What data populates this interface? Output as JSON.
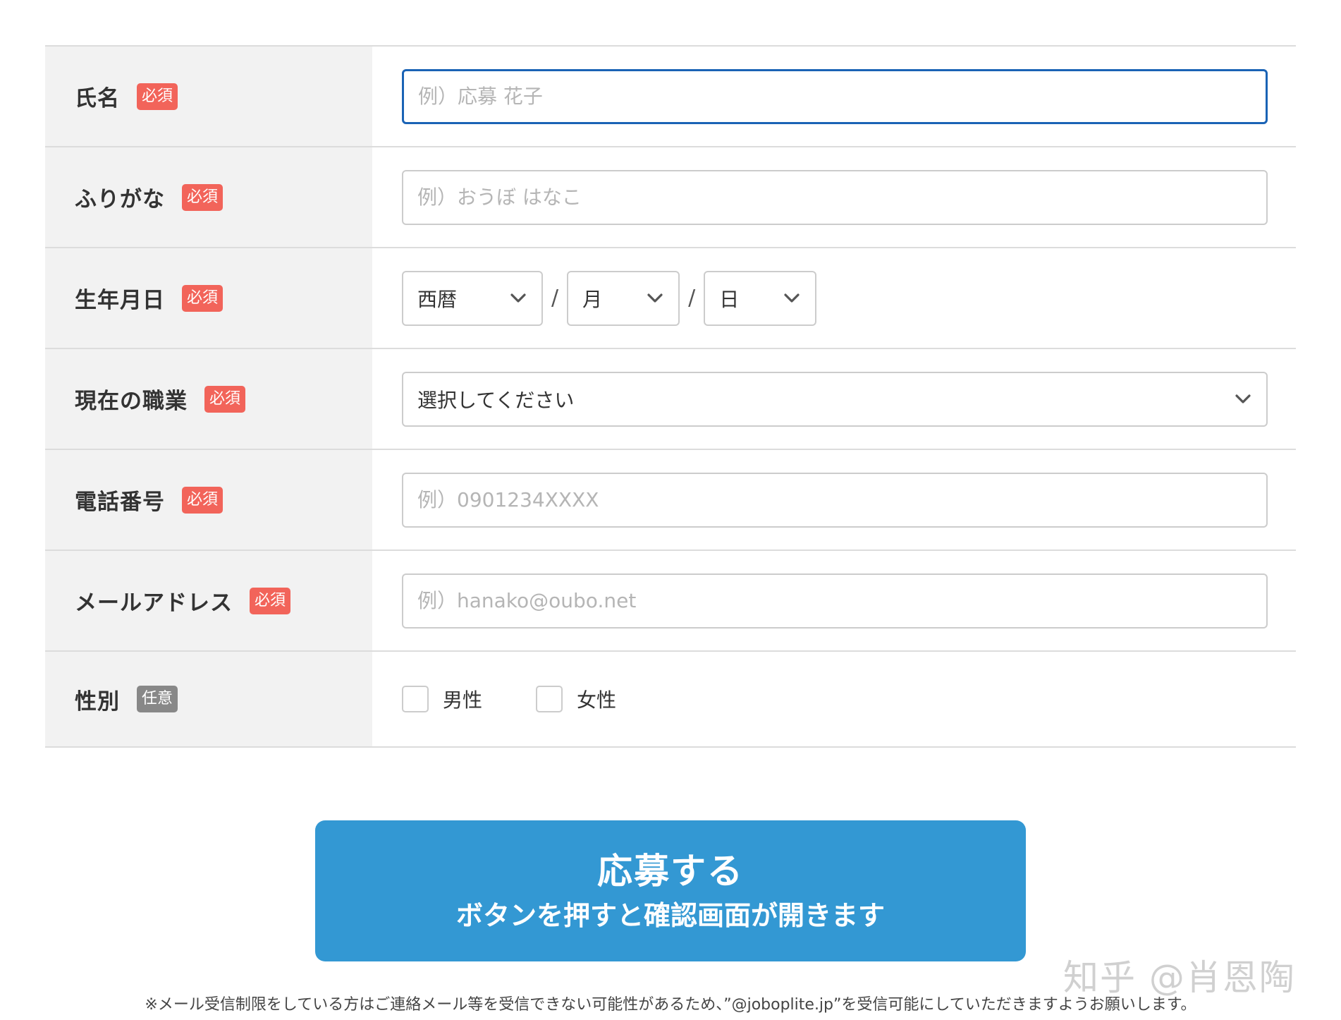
{
  "form": {
    "rows": [
      {
        "label": "氏名",
        "badge": "必須",
        "placeholder": "例）応募 花子"
      },
      {
        "label": "ふりがな",
        "badge": "必須",
        "placeholder": "例）おうぼ はなこ"
      },
      {
        "label": "生年月日",
        "badge": "必須",
        "year": "西暦",
        "month": "月",
        "day": "日",
        "separator": "/"
      },
      {
        "label": "現在の職業",
        "badge": "必須",
        "select_value": "選択してください"
      },
      {
        "label": "電話番号",
        "badge": "必須",
        "placeholder": "例）0901234XXXX"
      },
      {
        "label": "メールアドレス",
        "badge": "必須",
        "placeholder": "例）hanako@oubo.net"
      },
      {
        "label": "性別",
        "badge": "任意",
        "options": [
          "男性",
          "女性"
        ]
      }
    ]
  },
  "submit": {
    "main_label": "応募する",
    "sub_label": "ボタンを押すと確認画面が開きます"
  },
  "notice": "※メール受信制限をしている方はご連絡メール等を受信できない可能性があるため、”@joboplite.jp”を受信可能にしていただきますようお願いします。",
  "watermark": "知乎 @肖恩陶",
  "colors": {
    "required_badge": "#f2645a",
    "optional_badge": "#888888",
    "focus_border": "#1a63b5",
    "submit_button": "#3398d3",
    "label_background": "#f2f2f2"
  }
}
